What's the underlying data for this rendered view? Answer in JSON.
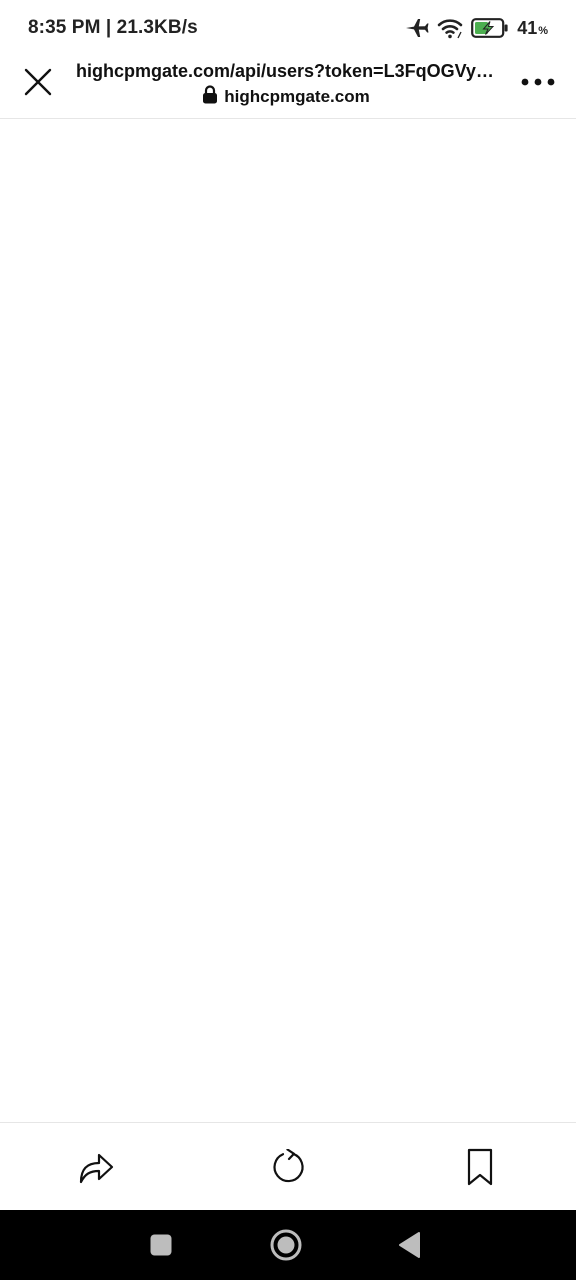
{
  "status_bar": {
    "time_speed": "8:35 PM | 21.3KB/s",
    "battery_percent": "41",
    "battery_symbol": "%",
    "icons": [
      "airplane-mode-icon",
      "wifi-icon",
      "battery-charging-icon"
    ]
  },
  "browser": {
    "url": "highcpmgate.com/api/users?token=L3FqOGVyQ...",
    "domain": "highcpmgate.com",
    "icons": [
      "close-icon",
      "lock-icon",
      "more-options-icon"
    ]
  },
  "toolbar": {
    "icons": [
      "share-icon",
      "reload-icon",
      "bookmark-icon"
    ]
  },
  "nav": {
    "icons": [
      "recent-apps-icon",
      "home-icon",
      "back-icon"
    ]
  },
  "colors": {
    "background": "#ffffff",
    "text": "#111111",
    "battery_green": "#4caf50",
    "nav_bar": "#000000",
    "divider": "#e6e6e6"
  }
}
